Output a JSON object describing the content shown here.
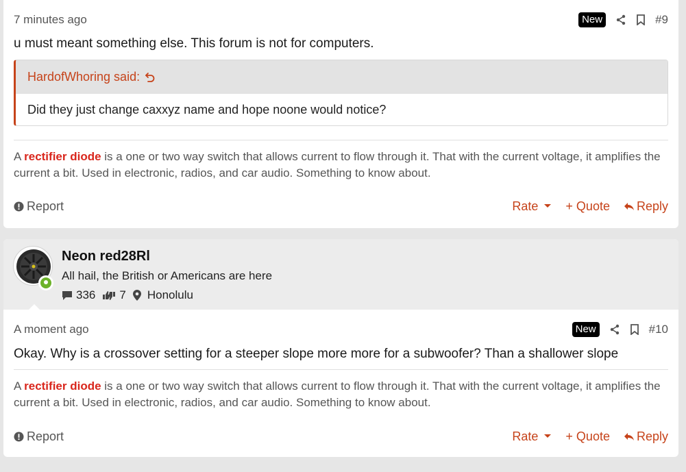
{
  "posts": [
    {
      "timestamp": "7 minutes ago",
      "badge": "New",
      "post_number": "#9",
      "body": "u must meant something else. This forum is not for computers.",
      "quote": {
        "author": "HardofWhoring said:",
        "text": "Did they just change caxxyz name and hope noone would notice?"
      },
      "signature": {
        "prefix": "A ",
        "term": "rectifier diode",
        "text": " is a one or two way switch that allows current to flow through it. That with the current voltage, it amplifies the current a bit. Used in electronic, radios, and car audio. Something to know about."
      },
      "actions": {
        "report": "Report",
        "rate": "Rate",
        "quote": "+ Quote",
        "reply": "Reply"
      }
    },
    {
      "user": {
        "name": "Neon red28Rl",
        "title": "All hail, the British or Americans are here",
        "messages": "336",
        "reactions": "7",
        "location": "Honolulu"
      },
      "timestamp": "A moment ago",
      "badge": "New",
      "post_number": "#10",
      "body": "Okay. Why is a crossover setting for a steeper slope more more for a subwoofer? Than a shallower slope",
      "signature": {
        "prefix": "A ",
        "term": "rectifier diode",
        "text": " is a one or two way switch that allows current to flow through it. That with the current voltage, it amplifies the current a bit. Used in electronic, radios, and car audio. Something to know about."
      },
      "actions": {
        "report": "Report",
        "rate": "Rate",
        "quote": "+ Quote",
        "reply": "Reply"
      }
    }
  ],
  "colors": {
    "accent": "#c6431a",
    "signature_term": "#d9261c",
    "online": "#6cb22a"
  }
}
